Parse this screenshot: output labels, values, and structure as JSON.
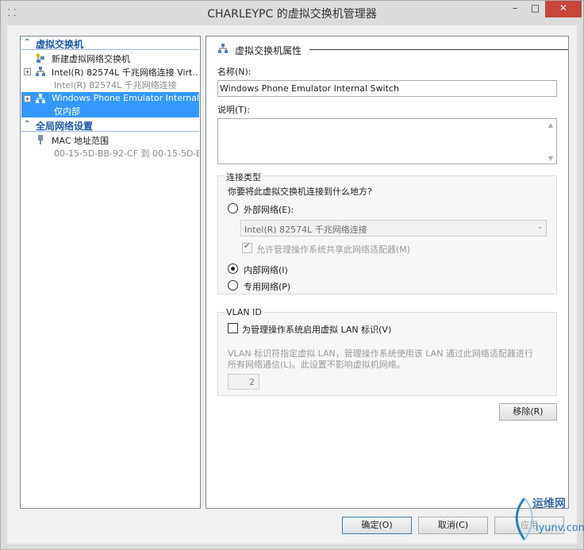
{
  "window": {
    "title": "CHARLEYPC 的虚拟交换机管理器"
  },
  "tree": {
    "section_switches": "虚拟交换机",
    "new_switch": "新建虚拟网络交换机",
    "switch1_label": "Intel(R) 82574L 千兆网络连接 Virt…",
    "switch1_sub": "Intel(R) 82574L 千兆网络连接",
    "switch2_label": "Windows Phone Emulator Internal …",
    "switch2_sub": "仅内部",
    "section_global": "全局网络设置",
    "mac_label": "MAC 地址范围",
    "mac_sub": "00-15-5D-BB-92-CF 到 00-15-5D-B…"
  },
  "panel": {
    "section_title": "虚拟交换机属性",
    "name_label": "名称(N):",
    "name_value": "Windows Phone Emulator Internal Switch",
    "notes_label": "说明(T):",
    "conn_group_title": "连接类型",
    "conn_question": "你要将此虚拟交换机连接到什么地方?",
    "external_label": "外部网络(E):",
    "adapter_value": "Intel(R) 82574L 千兆网络连接",
    "allow_mgmt_label": "允许管理操作系统共享此网络适配器(M)",
    "internal_label": "内部网络(I)",
    "private_label": "专用网络(P)",
    "selected_connection": "internal",
    "vlan_group_title": "VLAN ID",
    "vlan_enable_label": "为管理操作系统启用虚拟 LAN 标识(V)",
    "vlan_desc_line1": "VLAN 标识符指定虚拟 LAN，管理操作系统使用该 LAN 通过此网络适配器进行",
    "vlan_desc_line2": "所有网络通信(L)。此设置不影响虚拟机网络。",
    "vlan_value": "2",
    "remove_button": "移除(R)"
  },
  "footer": {
    "ok_button": "确定(O)",
    "cancel_button": "取消(C)",
    "apply_button": "应用"
  },
  "watermark": {
    "line1": "运维网",
    "line2": "iyunv.com"
  },
  "colors": {
    "selection": "#3399ff",
    "header_text": "#1e5aa8",
    "close_button": "#c7463a"
  }
}
